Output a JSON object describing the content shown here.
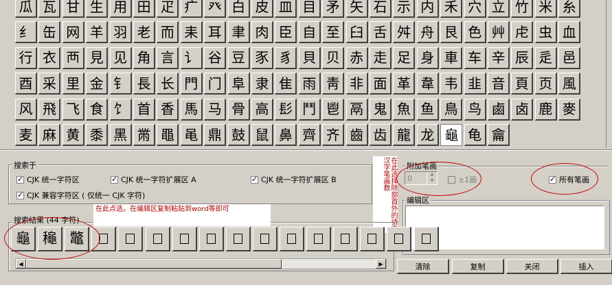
{
  "radicals": [
    [
      "瓜",
      "瓦",
      "甘",
      "生",
      "用",
      "田",
      "疋",
      "疒",
      "癶",
      "白",
      "皮",
      "皿",
      "目",
      "矛",
      "矢",
      "石",
      "示",
      "内",
      "禾",
      "穴",
      "立",
      "竹",
      "米",
      "糸"
    ],
    [
      "纟",
      "缶",
      "网",
      "羊",
      "羽",
      "老",
      "而",
      "耒",
      "耳",
      "聿",
      "肉",
      "臣",
      "自",
      "至",
      "臼",
      "舌",
      "舛",
      "舟",
      "艮",
      "色",
      "艸",
      "虍",
      "虫",
      "血"
    ],
    [
      "行",
      "衣",
      "襾",
      "見",
      "见",
      "角",
      "言",
      "讠",
      "谷",
      "豆",
      "豕",
      "豸",
      "貝",
      "贝",
      "赤",
      "走",
      "足",
      "身",
      "車",
      "车",
      "辛",
      "辰",
      "辵",
      "邑"
    ],
    [
      "酉",
      "采",
      "里",
      "金",
      "钅",
      "長",
      "长",
      "門",
      "门",
      "阜",
      "隶",
      "隹",
      "雨",
      "靑",
      "非",
      "面",
      "革",
      "韋",
      "韦",
      "韭",
      "音",
      "頁",
      "页",
      "風"
    ],
    [
      "风",
      "飛",
      "飞",
      "食",
      "饣",
      "首",
      "香",
      "馬",
      "马",
      "骨",
      "高",
      "髟",
      "鬥",
      "鬯",
      "鬲",
      "鬼",
      "魚",
      "鱼",
      "鳥",
      "鸟",
      "鹵",
      "卤",
      "鹿",
      "麥"
    ],
    [
      "麦",
      "麻",
      "黄",
      "黍",
      "黑",
      "黹",
      "黽",
      "黾",
      "鼎",
      "鼓",
      "鼠",
      "鼻",
      "齊",
      "齐",
      "齒",
      "齿",
      "龍",
      "龙",
      "龜",
      "龟",
      "龠"
    ]
  ],
  "selected_radical": "龜",
  "search_scope": {
    "label": "搜索于",
    "options": [
      {
        "label": "CJK 统一字符区",
        "checked": true
      },
      {
        "label": "CJK 统一字符扩展区 A",
        "checked": true
      },
      {
        "label": "CJK 统一字符扩展区 B",
        "checked": true
      },
      {
        "label": "CJK 兼容字符区 ( 仅统一 CJK 字符)",
        "checked": true
      }
    ]
  },
  "annotations": {
    "copy_note": "在此点选，在编辑区复制粘贴到word等即可",
    "stroke_note": "在此选择除部首外的待查汉字笔画数"
  },
  "strokes": {
    "label": "附加笔画",
    "value": "0",
    "plus_minus_label": "±1画",
    "all_strokes_label": "所有笔画",
    "all_strokes_checked": true
  },
  "results": {
    "label": "搜索结果 (44 字符)",
    "chars": [
      "龜",
      "龝",
      "鼈",
      "",
      "",
      "",
      "",
      "",
      "",
      "",
      "",
      "",
      "",
      "",
      "",
      ""
    ]
  },
  "edit_area": {
    "label": "编辑区",
    "value": ""
  },
  "buttons": {
    "clear": "清除",
    "copy": "复制",
    "close": "关闭",
    "insert": "插入"
  },
  "colors": {
    "face": "#d4d0c8",
    "annotation": "#c00000"
  }
}
